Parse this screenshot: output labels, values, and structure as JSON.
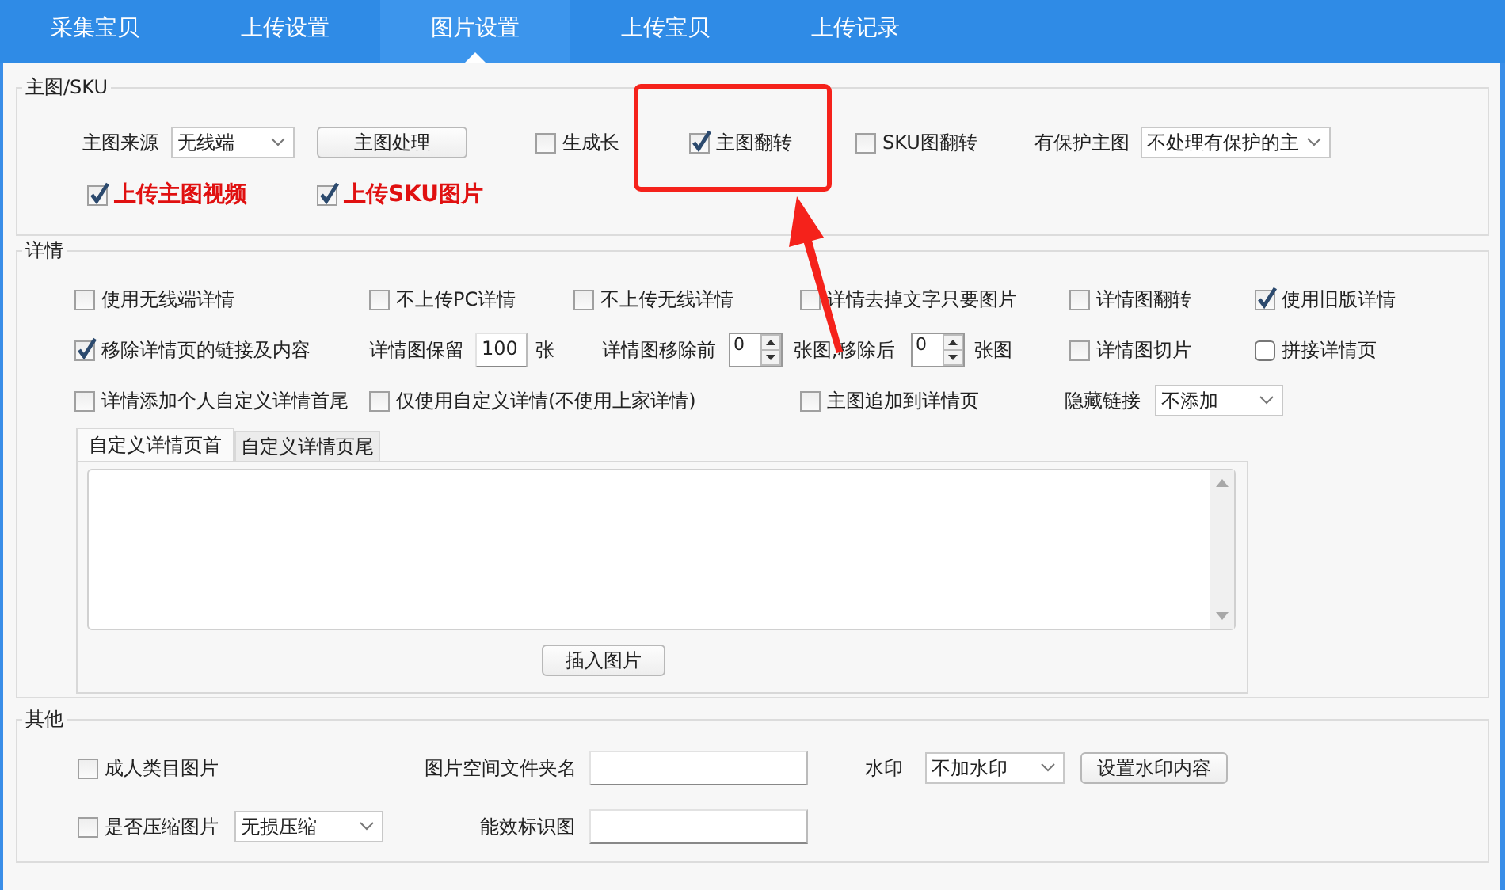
{
  "tabs": [
    {
      "label": "采集宝贝",
      "selected": false
    },
    {
      "label": "上传设置",
      "selected": false
    },
    {
      "label": "图片设置",
      "selected": true
    },
    {
      "label": "上传宝贝",
      "selected": false
    },
    {
      "label": "上传记录",
      "selected": false
    }
  ],
  "groups": [
    {
      "title": "主图/SKU",
      "rows": [
        {
          "items": [
            {
              "kind": "label",
              "text": "主图来源"
            },
            {
              "kind": "select",
              "value": "无线端"
            },
            {
              "kind": "button",
              "label": "主图处理"
            },
            {
              "kind": "checkbox",
              "label": "生成长",
              "checked": false
            },
            {
              "kind": "checkbox",
              "label": "主图翻转",
              "checked": true
            },
            {
              "kind": "checkbox",
              "label": "SKU图翻转",
              "checked": false
            },
            {
              "kind": "label",
              "text": "有保护主图"
            },
            {
              "kind": "select",
              "value": "不处理有保护的主"
            }
          ]
        },
        {
          "items": [
            {
              "kind": "checkbox",
              "label": "上传主图视频",
              "checked": true,
              "emphasis": true
            },
            {
              "kind": "checkbox",
              "label": "上传SKU图片",
              "checked": true,
              "emphasis": true
            }
          ]
        }
      ]
    },
    {
      "title": "详情",
      "rows": [
        {
          "items": [
            {
              "kind": "checkbox",
              "label": "使用无线端详情",
              "checked": false
            },
            {
              "kind": "checkbox",
              "label": "不上传PC详情",
              "checked": false
            },
            {
              "kind": "checkbox",
              "label": "不上传无线详情",
              "checked": false
            },
            {
              "kind": "checkbox",
              "label": "详情去掉文字只要图片",
              "checked": false
            },
            {
              "kind": "checkbox",
              "label": "详情图翻转",
              "checked": false
            },
            {
              "kind": "checkbox",
              "label": "使用旧版详情",
              "checked": true
            }
          ]
        },
        {
          "items": [
            {
              "kind": "checkbox",
              "label": "移除详情页的链接及内容",
              "checked": true
            },
            {
              "kind": "label",
              "text": "详情图保留"
            },
            {
              "kind": "input",
              "value": "100"
            },
            {
              "kind": "label",
              "text": "张"
            },
            {
              "kind": "label",
              "text": "详情图移除前"
            },
            {
              "kind": "spin",
              "value": "0"
            },
            {
              "kind": "label",
              "text": "张图,移除后"
            },
            {
              "kind": "spin",
              "value": "0"
            },
            {
              "kind": "label",
              "text": "张图"
            },
            {
              "kind": "checkbox",
              "label": "详情图切片",
              "checked": false
            },
            {
              "kind": "checkbox",
              "label": "拼接详情页",
              "checked": false
            }
          ]
        },
        {
          "items": [
            {
              "kind": "checkbox",
              "label": "详情添加个人自定义详情首尾",
              "checked": false
            },
            {
              "kind": "checkbox",
              "label": "仅使用自定义详情(不使用上家详情)",
              "checked": false
            },
            {
              "kind": "checkbox",
              "label": "主图追加到详情页",
              "checked": false
            },
            {
              "kind": "label",
              "text": "隐藏链接"
            },
            {
              "kind": "select",
              "value": "不添加"
            }
          ]
        }
      ],
      "editor": {
        "tabs": [
          {
            "label": "自定义详情页首",
            "selected": true
          },
          {
            "label": "自定义详情页尾",
            "selected": false
          }
        ],
        "button": "插入图片"
      }
    },
    {
      "title": "其他",
      "rows": [
        {
          "items": [
            {
              "kind": "checkbox",
              "label": "成人类目图片",
              "checked": false
            },
            {
              "kind": "label",
              "text": "图片空间文件夹名"
            },
            {
              "kind": "input",
              "value": ""
            },
            {
              "kind": "label",
              "text": "水印"
            },
            {
              "kind": "select",
              "value": "不加水印"
            },
            {
              "kind": "button",
              "label": "设置水印内容"
            }
          ]
        },
        {
          "items": [
            {
              "kind": "checkbox",
              "label": "是否压缩图片",
              "checked": false
            },
            {
              "kind": "select",
              "value": "无损压缩"
            },
            {
              "kind": "label",
              "text": "能效标识图"
            },
            {
              "kind": "input",
              "value": ""
            }
          ]
        }
      ]
    }
  ]
}
